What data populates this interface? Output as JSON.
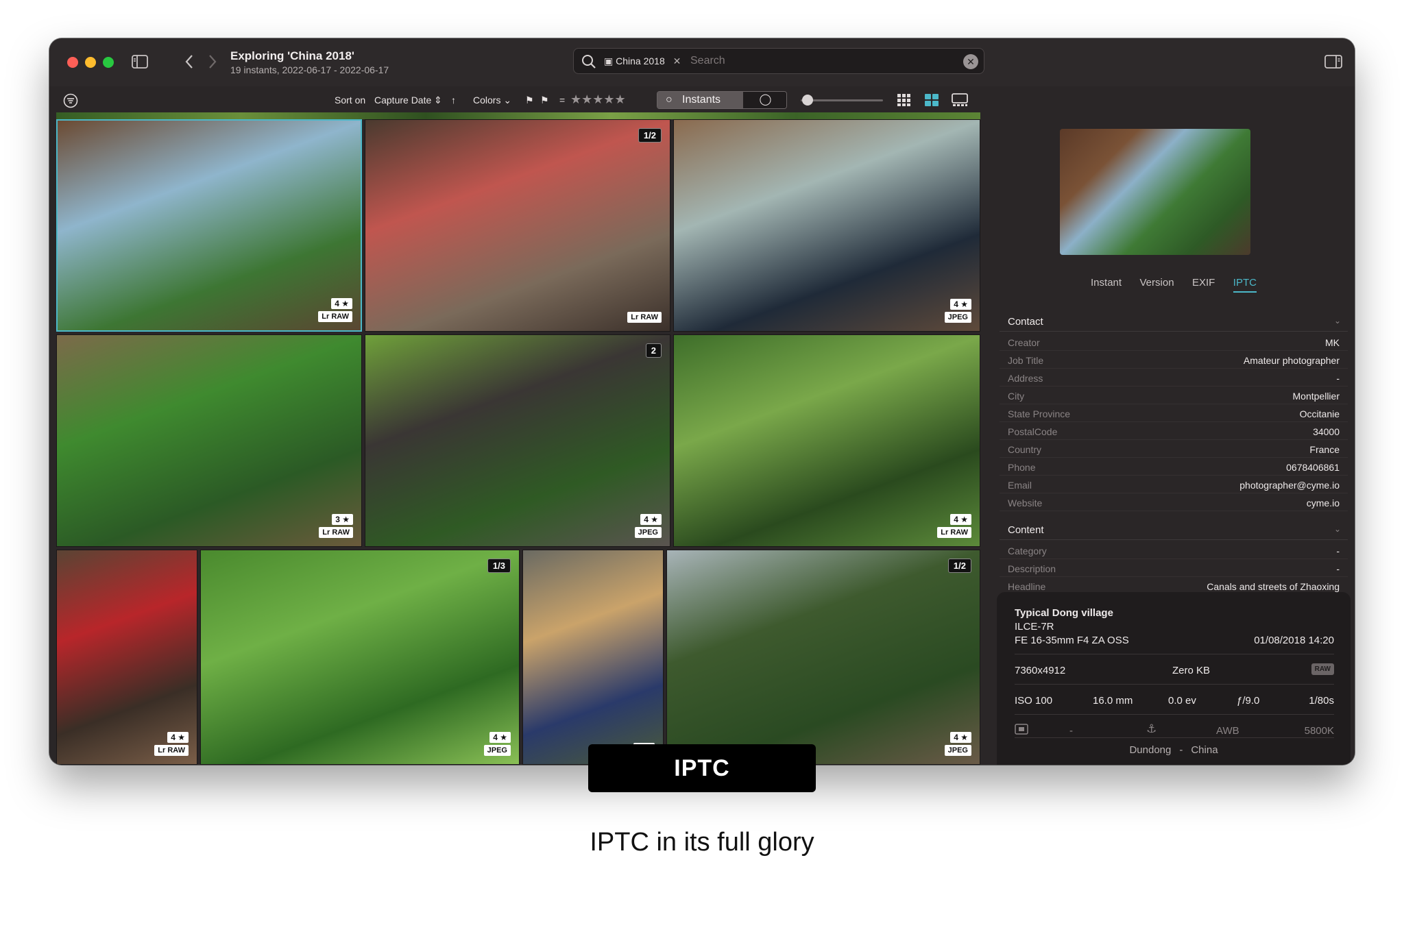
{
  "window": {
    "title": "Exploring 'China 2018'",
    "subtitle": "19 instants, 2022-06-17 - 2022-06-17"
  },
  "search": {
    "tag": "China 2018",
    "placeholder": "Search"
  },
  "toolbar": {
    "sort_label": "Sort on",
    "sort_value": "Capture Date",
    "colors_label": "Colors",
    "rating_eq": "=",
    "rating_stars": "★★★★★",
    "seg_instants": "Instants",
    "seg_other": "◯"
  },
  "photos": [
    {
      "stars": "4 ★",
      "format": "Lr RAW",
      "badge": "",
      "colors": [
        "#6b4a32",
        "#8fb5cc",
        "#3d7633",
        "#5a4632"
      ]
    },
    {
      "stars": "",
      "format": "Lr RAW",
      "badge": "1/2",
      "colors": [
        "#4a3a2f",
        "#c0564f",
        "#7a6a5a",
        "#3b302a"
      ]
    },
    {
      "stars": "4 ★",
      "format": "JPEG",
      "badge": "",
      "colors": [
        "#8a6a4e",
        "#a3b6b3",
        "#1f2a38",
        "#5f4a3a"
      ]
    },
    {
      "stars": "3 ★",
      "format": "Lr RAW",
      "badge": "",
      "colors": [
        "#7c6a4a",
        "#3f8a2f",
        "#2b5a25",
        "#6b5a3c"
      ]
    },
    {
      "stars": "4 ★",
      "format": "JPEG",
      "badge": "2",
      "colors": [
        "#6fa03a",
        "#3a3634",
        "#2f5a24",
        "#5a5450"
      ]
    },
    {
      "stars": "4 ★",
      "format": "Lr RAW",
      "badge": "",
      "colors": [
        "#3e6e2a",
        "#7aa84a",
        "#2a4a1e",
        "#5c8a3a"
      ]
    },
    {
      "stars": "4 ★",
      "format": "Lr RAW",
      "badge": "",
      "colors": [
        "#5a4434",
        "#b8262a",
        "#3a2e26",
        "#7a5e48"
      ]
    },
    {
      "stars": "4 ★",
      "format": "JPEG",
      "badge": "1/3",
      "colors": [
        "#4a8a2e",
        "#6fb046",
        "#2e6a22",
        "#8ac056"
      ]
    },
    {
      "stars": "4 ★",
      "format": "",
      "badge": "",
      "colors": [
        "#6a6a62",
        "#caa36a",
        "#2a3a6a",
        "#4a5a3a"
      ]
    },
    {
      "stars": "4 ★",
      "format": "JPEG",
      "badge": "1/2",
      "colors": [
        "#a8b4b8",
        "#3e5a2e",
        "#2a4a22",
        "#6a5a48"
      ]
    }
  ],
  "sidebar": {
    "tabs": [
      "Instant",
      "Version",
      "EXIF",
      "IPTC"
    ],
    "active_tab": "IPTC",
    "contact_title": "Contact",
    "contact": [
      {
        "k": "Creator",
        "v": "MK"
      },
      {
        "k": "Job Title",
        "v": "Amateur photographer"
      },
      {
        "k": "Address",
        "v": "-"
      },
      {
        "k": "City",
        "v": "Montpellier"
      },
      {
        "k": "State Province",
        "v": "Occitanie"
      },
      {
        "k": "PostalCode",
        "v": "34000"
      },
      {
        "k": "Country",
        "v": "France"
      },
      {
        "k": "Phone",
        "v": "0678406861"
      },
      {
        "k": "Email",
        "v": "photographer@cyme.io"
      },
      {
        "k": "Website",
        "v": "cyme.io"
      }
    ],
    "content_title": "Content",
    "content": [
      {
        "k": "Category",
        "v": "-"
      },
      {
        "k": "Description",
        "v": "-"
      },
      {
        "k": "Headline",
        "v": "Canals and streets of Zhaoxing"
      },
      {
        "k": "Description Writer",
        "v": ""
      }
    ]
  },
  "info": {
    "title": "Typical Dong village",
    "camera": "ILCE-7R",
    "lens": "FE 16-35mm F4 ZA OSS",
    "date": "01/08/2018 14:20",
    "dimensions": "7360x4912",
    "size": "Zero KB",
    "format": "RAW",
    "iso": "ISO 100",
    "focal": "16.0 mm",
    "ev": "0.0 ev",
    "aperture": "ƒ/9.0",
    "shutter": "1/80s",
    "meter": "-",
    "wb": "AWB",
    "kelvin": "5800K",
    "city": "Dundong",
    "sep": "-",
    "country": "China"
  },
  "overlay_label": "IPTC",
  "caption": "IPTC in its full glory"
}
